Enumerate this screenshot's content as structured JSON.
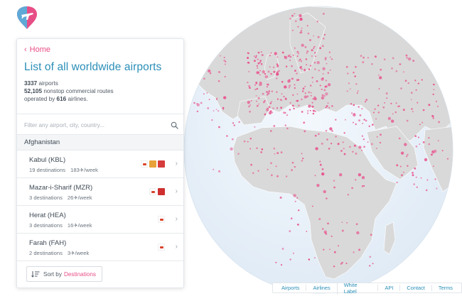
{
  "panel": {
    "home_label": "Home",
    "title": "List of all worldwide airports",
    "stats": {
      "airports_count": "3337",
      "airports_label": " airports",
      "routes_count": "52,105",
      "routes_label": " nonstop commercial routes",
      "operated_prefix": "operated by ",
      "airlines_count": "616",
      "airlines_suffix": " airlines."
    },
    "search_placeholder": "Filter any airport, city, country...",
    "country": "Afghanistan",
    "airports": [
      {
        "name": "Kabul (KBL)",
        "destinations": "19 destinations",
        "weekly": "183✈/week",
        "logos": [
          "#d9442b",
          "#e8a23a",
          "#d63c3c"
        ]
      },
      {
        "name": "Mazar-i-Sharif (MZR)",
        "destinations": "3 destinations",
        "weekly": "26✈/week",
        "logos": [
          "#d9442b",
          "#cf2f2f"
        ]
      },
      {
        "name": "Herat (HEA)",
        "destinations": "3 destinations",
        "weekly": "16✈/week",
        "logos": [
          "#d9442b"
        ]
      },
      {
        "name": "Farah (FAH)",
        "destinations": "2 destinations",
        "weekly": "3✈/week",
        "logos": [
          "#d9442b"
        ]
      }
    ],
    "sort_prefix": "Sort by",
    "sort_value": "Destinations"
  },
  "footer": {
    "links": [
      "Airports",
      "Airlines",
      "White Label",
      "API",
      "Contact",
      "Terms"
    ]
  },
  "colors": {
    "accent_pink": "#e84e86",
    "accent_blue": "#2b8fb8",
    "land": "#d9d9d9",
    "ocean": "#e9f3fb",
    "airport_dot": "#e8578f"
  },
  "icons": {
    "logo": "plane-pin-logo",
    "search": "search-icon",
    "sort": "sort-icon",
    "row": "chevron-right-icon"
  }
}
